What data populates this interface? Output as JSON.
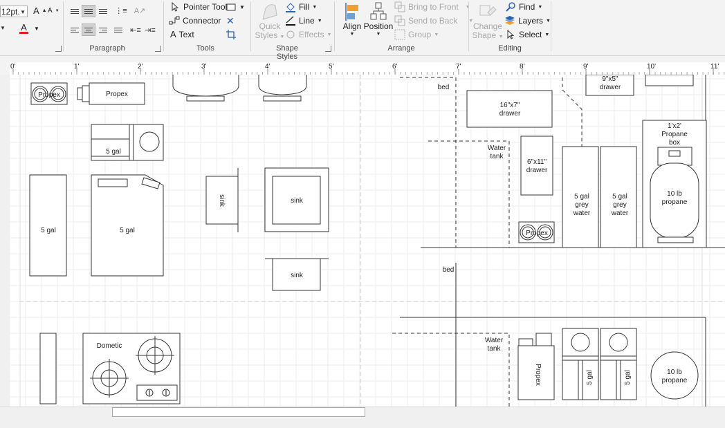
{
  "font": {
    "size": "12pt.",
    "grow_label": "A",
    "shrink_label": "A",
    "color_label": "A"
  },
  "ribbon": {
    "groups": {
      "paragraph": "Paragraph",
      "tools": "Tools",
      "shape_styles": "Shape Styles",
      "arrange": "Arrange",
      "editing": "Editing"
    },
    "tools": {
      "pointer": "Pointer Tool",
      "connector": "Connector",
      "text": "Text"
    },
    "shape_styles": {
      "quick_styles_1": "Quick",
      "quick_styles_2": "Styles",
      "fill": "Fill",
      "line": "Line",
      "effects": "Effects"
    },
    "arrange": {
      "align": "Align",
      "position": "Position",
      "bring_to_front": "Bring to Front",
      "send_to_back": "Send to Back",
      "group": "Group"
    },
    "editing": {
      "change_shape_1": "Change",
      "change_shape_2": "Shape",
      "find": "Find",
      "layers": "Layers",
      "select": "Select"
    }
  },
  "ruler": {
    "marks": [
      "0'",
      "1'",
      "2'",
      "3'",
      "4'",
      "5'",
      "6'",
      "7'",
      "8'",
      "9'",
      "10'",
      "11'"
    ]
  },
  "shapes": {
    "propex_1": "Propex",
    "propex_2": "Propex",
    "gal_a": "5 gal",
    "gal_b": "5 gal",
    "gal_c": "5 gal",
    "sink_side": "sink",
    "sink_1": "sink",
    "sink_2": "sink",
    "dometic": "Dometic",
    "bed_top": "bed",
    "drawer_16x7_1": "16\"x7\"",
    "drawer_16x7_2": "drawer",
    "drawer_9x5_1": "9\"x5\"",
    "drawer_9x5_2": "drawer",
    "water_tank_1a": "Water",
    "water_tank_1b": "tank",
    "drawer_6x11_1": "6\"x11\"",
    "drawer_6x11_2": "drawer",
    "grey_1a": "5 gal",
    "grey_1b": "grey",
    "grey_1c": "water",
    "grey_2a": "5 gal",
    "grey_2b": "grey",
    "grey_2c": "water",
    "propane_box_1": "1'x2'",
    "propane_box_2": "Propane",
    "propane_box_3": "box",
    "propane_10lb_1a": "10 lb",
    "propane_10lb_1b": "propane",
    "propex_3": "Propex",
    "bed_mid": "bed",
    "water_tank_2a": "Water",
    "water_tank_2b": "tank",
    "propex_4": "Propex",
    "gal_d": "5 gal",
    "gal_e": "5 gal",
    "propane_10lb_2a": "10 lb",
    "propane_10lb_2b": "propane"
  }
}
